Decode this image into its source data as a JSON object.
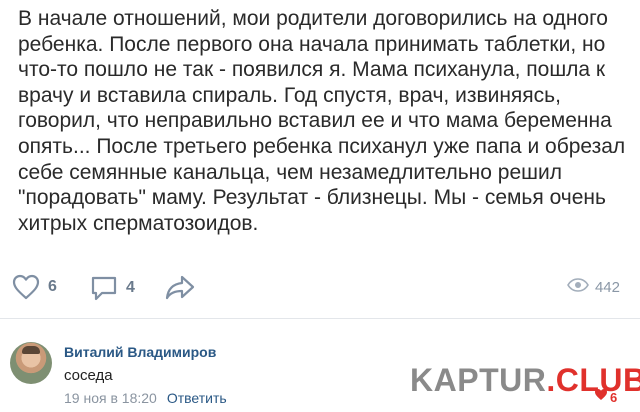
{
  "post": {
    "lines": [
      "В начале отношений, мои родители договорились на одного",
      "ребенка. После первого она начала принимать таблетки, но",
      "что-то пошло не так - появился я. Мама психанула, пошла к",
      "врачу и вставила спираль. Год спустя, врач, извиняясь,",
      "говорил, что неправильно вставил ее и что мама беременна",
      "опять... После третьего ребенка психанул уже папа и обрезал",
      "себе семянные канальца, чем незамедлительно решил",
      "\"порадовать\" маму. Результат - близнецы. Мы - семья очень",
      "хитрых сперматозоидов."
    ]
  },
  "actions": {
    "likes": "6",
    "comments": "4",
    "views": "442",
    "icons": {
      "like": "heart-icon",
      "comment": "comment-icon",
      "share": "share-icon",
      "views": "eye-icon"
    }
  },
  "comment": {
    "author": "Виталий Владимиров",
    "text": "соседа",
    "date": "19 ноя в 18:20",
    "reply_label": "Ответить",
    "likes": "6"
  },
  "watermark": {
    "main": "KAPTUR",
    "tld": ".CLUB"
  },
  "colors": {
    "link": "#2a5885",
    "muted": "#8a94a0",
    "accent": "#e0312c"
  }
}
